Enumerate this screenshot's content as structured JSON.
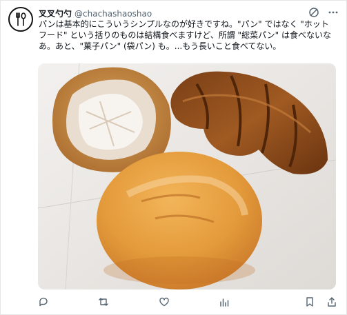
{
  "tweet": {
    "display_name": "叉叉勺勺",
    "handle": "@chachashaoshao",
    "text": "パンは基本的にこういうシンプルなのが好きですね。\"パン\" ではなく \"ホットフード\" という括りのものは結構食べますけど、所謂 \"総菜パン\" は食べないなあ。あと、\"菓子パン\" (袋パン) も。...もう長いこと食べてない。"
  },
  "photo": {
    "subject": "three breads on white paper: pastry with powdered sugar, croissant, round bun"
  },
  "actions": {
    "icons": [
      "reply-icon",
      "retweet-icon",
      "like-icon",
      "views-icon",
      "bookmark-icon",
      "share-icon"
    ]
  },
  "colors": {
    "text": "#0f1419",
    "muted": "#536471",
    "accent": "#1d9bf0"
  }
}
